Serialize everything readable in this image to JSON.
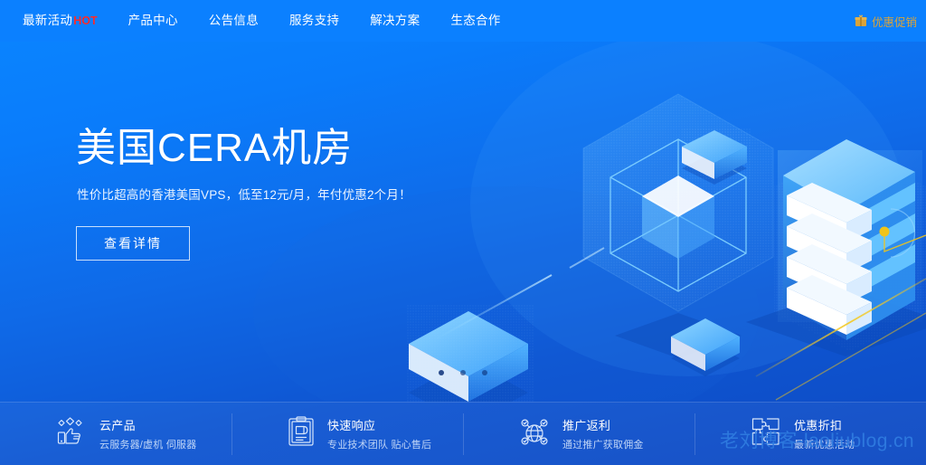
{
  "nav": {
    "items": [
      {
        "label": "最新活动",
        "badge": "HOT"
      },
      {
        "label": "产品中心",
        "badge": ""
      },
      {
        "label": "公告信息",
        "badge": ""
      },
      {
        "label": "服务支持",
        "badge": ""
      },
      {
        "label": "解决方案",
        "badge": ""
      },
      {
        "label": "生态合作",
        "badge": ""
      }
    ],
    "promo": {
      "label": "优惠促销",
      "icon": "gift-icon",
      "color": "#d9a33a"
    },
    "background": "#0b80ff",
    "text_color": "#ffffff",
    "badge_color": "#ff2a2a"
  },
  "hero": {
    "title": "美国CERA机房",
    "subtitle": "性价比超高的香港美国VPS，低至12元/月，年付优惠2个月！",
    "button_label": "查看详情"
  },
  "carousel": {
    "dots": [
      "1",
      "2",
      "3"
    ],
    "active_index": 0
  },
  "features": [
    {
      "icon": "thumbs-up-icon",
      "title": "云产品",
      "desc": "云服务器/虚机 伺服器"
    },
    {
      "icon": "clipboard-icon",
      "title": "快速响应",
      "desc": "专业技术团队 贴心售后"
    },
    {
      "icon": "globe-network-icon",
      "title": "推广返利",
      "desc": "通过推广获取佣金"
    },
    {
      "icon": "puzzle-icon",
      "title": "优惠折扣",
      "desc": "最新优惠活动"
    }
  ],
  "watermark": {
    "text": "老刘博客-laoliublog.cn",
    "color": "#2f7be0"
  },
  "theme": {
    "bg_top": "#0a86ff",
    "bg_bottom": "#0d49c2",
    "accent_yellow": "#f0c419",
    "illustration_light": "#6ec8ff"
  }
}
